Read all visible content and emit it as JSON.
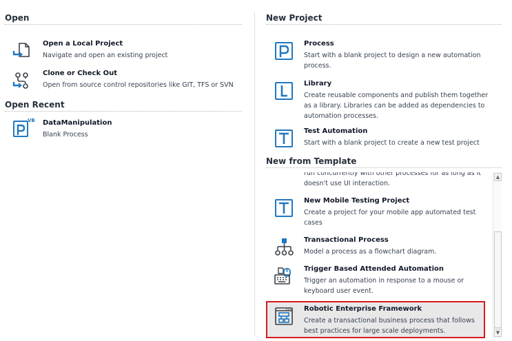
{
  "open": {
    "header": "Open",
    "items": [
      {
        "title": "Open a Local Project",
        "desc": "Navigate and open an existing project",
        "icon": "open-file-icon"
      },
      {
        "title": "Clone or Check Out",
        "desc": "Open from source control repositories like GIT, TFS or SVN",
        "icon": "source-control-icon"
      }
    ]
  },
  "recent": {
    "header": "Open Recent",
    "items": [
      {
        "title": "DataManipulation",
        "desc": "Blank Process",
        "badge": "VB",
        "icon": "process-p-icon"
      }
    ]
  },
  "new_project": {
    "header": "New Project",
    "items": [
      {
        "title": "Process",
        "desc": "Start with a blank project to design a new automation process.",
        "icon": "process-p-icon"
      },
      {
        "title": "Library",
        "desc": "Create reusable components and publish them together as a library. Libraries can be added as dependencies to automation processes.",
        "icon": "library-l-icon"
      },
      {
        "title": "Test Automation",
        "desc": "Start with a blank project to create a new test project",
        "icon": "test-t-icon"
      }
    ]
  },
  "templates": {
    "header": "New from Template",
    "partial_desc": "run concurrently with other processes for as long as it doesn't use UI interaction.",
    "items": [
      {
        "title": "New Mobile Testing Project",
        "desc": "Create a project for your mobile app automated test cases",
        "icon": "test-t-icon"
      },
      {
        "title": "Transactional Process",
        "desc": "Model a process as a flowchart diagram.",
        "icon": "flowchart-icon"
      },
      {
        "title": "Trigger Based Attended Automation",
        "desc": "Trigger an automation in response to a mouse or keyboard user event.",
        "icon": "trigger-keyboard-mouse-icon"
      },
      {
        "title": "Robotic Enterprise Framework",
        "desc": "Create a transactional business process that follows best practices for large scale deployments.",
        "icon": "reframework-icon"
      }
    ]
  },
  "colors": {
    "accent": "#1f78c1",
    "highlight_border": "#d7191f",
    "highlight_bg": "#e8e8e8"
  }
}
